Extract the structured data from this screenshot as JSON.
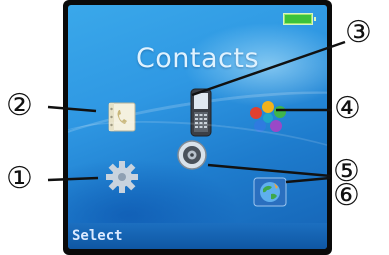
{
  "screen": {
    "title": "Contacts",
    "softkey_left": "Select"
  },
  "callouts": {
    "c1": "①",
    "c2": "②",
    "c3": "③",
    "c4": "④",
    "c5": "⑤",
    "c6": "⑥"
  },
  "icons": [
    "phonebook-icon",
    "phone-icon",
    "color-balls-icon",
    "settings-gear-icon",
    "speaker-icon",
    "globe-icon"
  ],
  "colors": {
    "screen_top": "#3aa8ea",
    "screen_bottom": "#1563b5",
    "battery": "#3cc23a",
    "softbar": "#1c6fc0"
  }
}
